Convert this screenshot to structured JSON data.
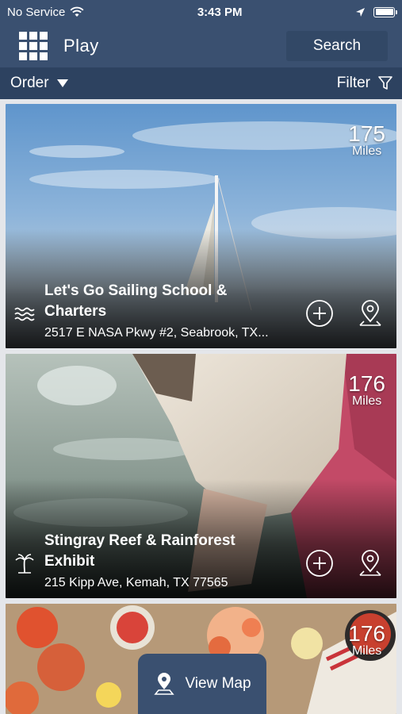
{
  "status_bar": {
    "carrier": "No Service",
    "time": "3:43 PM",
    "icons": [
      "wifi-icon",
      "location-arrow-icon",
      "battery-icon"
    ]
  },
  "nav": {
    "title": "Play",
    "search_label": "Search",
    "menu_icon": "grid-icon"
  },
  "toolbar": {
    "order_label": "Order",
    "filter_label": "Filter"
  },
  "listings": [
    {
      "title_line1": "Let's Go Sailing School &",
      "title_line2": "Charters",
      "address": "2517 E NASA Pkwy #2, Seabrook, TX...",
      "distance": "175",
      "unit": "Miles",
      "category_icon": "waves-icon"
    },
    {
      "title_line1": "Stingray Reef & Rainforest",
      "title_line2": "Exhibit",
      "address": "215 Kipp Ave, Kemah, TX 77565",
      "distance": "176",
      "unit": "Miles",
      "category_icon": "palm-tree-icon"
    },
    {
      "distance": "176",
      "unit": "Miles"
    }
  ],
  "view_map_label": "View Map",
  "colors": {
    "header": "#3a5070",
    "toolbar": "#2d4260",
    "search_button": "#324866"
  }
}
